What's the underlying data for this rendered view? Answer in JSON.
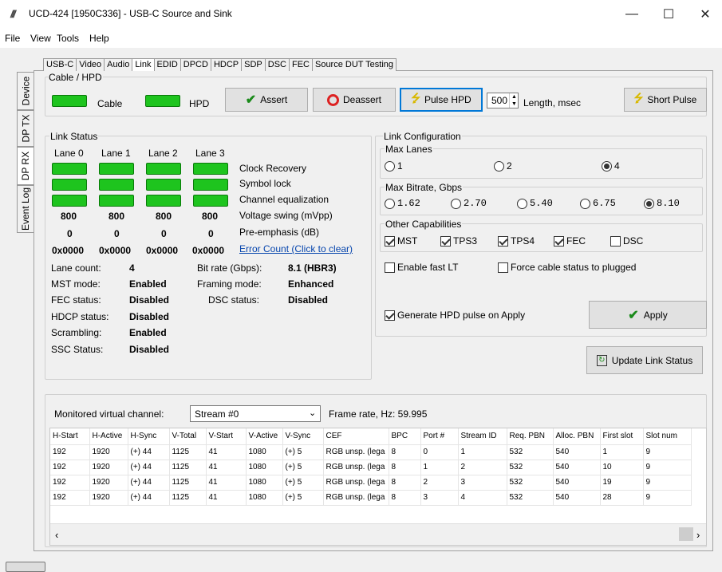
{
  "window": {
    "title": "UCD-424 [1950C336] - USB-C Source and Sink",
    "icon": "app-logo-icon"
  },
  "menu": [
    "File",
    "View",
    "Tools",
    "Help"
  ],
  "side_tabs": [
    "Device",
    "DP TX",
    "DP RX",
    "Event Log"
  ],
  "top_tabs": [
    "USB-C",
    "Video",
    "Audio",
    "Link",
    "EDID",
    "DPCD",
    "HDCP",
    "SDP",
    "DSC",
    "FEC",
    "Source DUT Testing"
  ],
  "cable_hpd": {
    "group_label": "Cable / HPD",
    "cable_label": "Cable",
    "hpd_label": "HPD",
    "assert_label": "Assert",
    "deassert_label": "Deassert",
    "pulse_label": "Pulse HPD",
    "length_value": "500",
    "length_label": "Length, msec",
    "short_pulse_label": "Short Pulse"
  },
  "link_status": {
    "group_label": "Link Status",
    "lanes": [
      "Lane 0",
      "Lane 1",
      "Lane 2",
      "Lane 3"
    ],
    "row_labels": [
      "Clock Recovery",
      "Symbol lock",
      "Channel equalization",
      "Voltage swing (mVpp)",
      "Pre-emphasis (dB)"
    ],
    "voltage": [
      "800",
      "800",
      "800",
      "800"
    ],
    "preemph": [
      "0",
      "0",
      "0",
      "0"
    ],
    "errors": [
      "0x0000",
      "0x0000",
      "0x0000",
      "0x0000"
    ],
    "error_link": "Error Count (Click to clear)",
    "left": [
      {
        "k": "Lane count:",
        "v": "4"
      },
      {
        "k": "MST mode:",
        "v": "Enabled"
      },
      {
        "k": "FEC status:",
        "v": "Disabled"
      },
      {
        "k": "HDCP status:",
        "v": "Disabled"
      },
      {
        "k": "Scrambling:",
        "v": "Enabled"
      },
      {
        "k": "SSC Status:",
        "v": "Disabled"
      }
    ],
    "right": [
      {
        "k": "Bit rate (Gbps):",
        "v": "8.1 (HBR3)"
      },
      {
        "k": "Framing mode:",
        "v": "Enhanced"
      },
      {
        "k": "DSC status:",
        "v": "Disabled"
      }
    ]
  },
  "link_config": {
    "group_label": "Link Configuration",
    "max_lanes_label": "Max Lanes",
    "lanes": [
      "1",
      "2",
      "4"
    ],
    "lanes_selected": "4",
    "bitrate_label": "Max Bitrate, Gbps",
    "bitrates": [
      "1.62",
      "2.70",
      "5.40",
      "6.75",
      "8.10"
    ],
    "bitrate_selected": "8.10",
    "caps_label": "Other Capabilities",
    "caps": [
      {
        "name": "MST",
        "checked": true
      },
      {
        "name": "TPS3",
        "checked": true
      },
      {
        "name": "TPS4",
        "checked": true
      },
      {
        "name": "FEC",
        "checked": true
      },
      {
        "name": "DSC",
        "checked": false
      }
    ],
    "fast_lt_label": "Enable fast LT",
    "force_cable_label": "Force cable status to plugged",
    "gen_hpd_label": "Generate HPD pulse on Apply",
    "apply_label": "Apply",
    "update_label": "Update Link Status"
  },
  "monitor": {
    "channel_label": "Monitored virtual channel:",
    "stream_value": "Stream #0",
    "frame_rate_label": "Frame rate, Hz: 59.995",
    "columns": [
      "H-Start",
      "H-Active",
      "H-Sync",
      "V-Total",
      "V-Start",
      "V-Active",
      "V-Sync",
      "CEF",
      "BPC",
      "Port #",
      "Stream ID",
      "Req. PBN",
      "Alloc. PBN",
      "First slot",
      "Slot num"
    ],
    "rows": [
      [
        "192",
        "1920",
        "(+) 44",
        "1125",
        "41",
        "1080",
        "(+) 5",
        "RGB unsp. (lega",
        "8",
        "0",
        "1",
        "532",
        "540",
        "1",
        "9"
      ],
      [
        "192",
        "1920",
        "(+) 44",
        "1125",
        "41",
        "1080",
        "(+) 5",
        "RGB unsp. (lega",
        "8",
        "1",
        "2",
        "532",
        "540",
        "10",
        "9"
      ],
      [
        "192",
        "1920",
        "(+) 44",
        "1125",
        "41",
        "1080",
        "(+) 5",
        "RGB unsp. (lega",
        "8",
        "2",
        "3",
        "532",
        "540",
        "19",
        "9"
      ],
      [
        "192",
        "1920",
        "(+) 44",
        "1125",
        "41",
        "1080",
        "(+) 5",
        "RGB unsp. (lega",
        "8",
        "3",
        "4",
        "532",
        "540",
        "28",
        "9"
      ]
    ]
  }
}
